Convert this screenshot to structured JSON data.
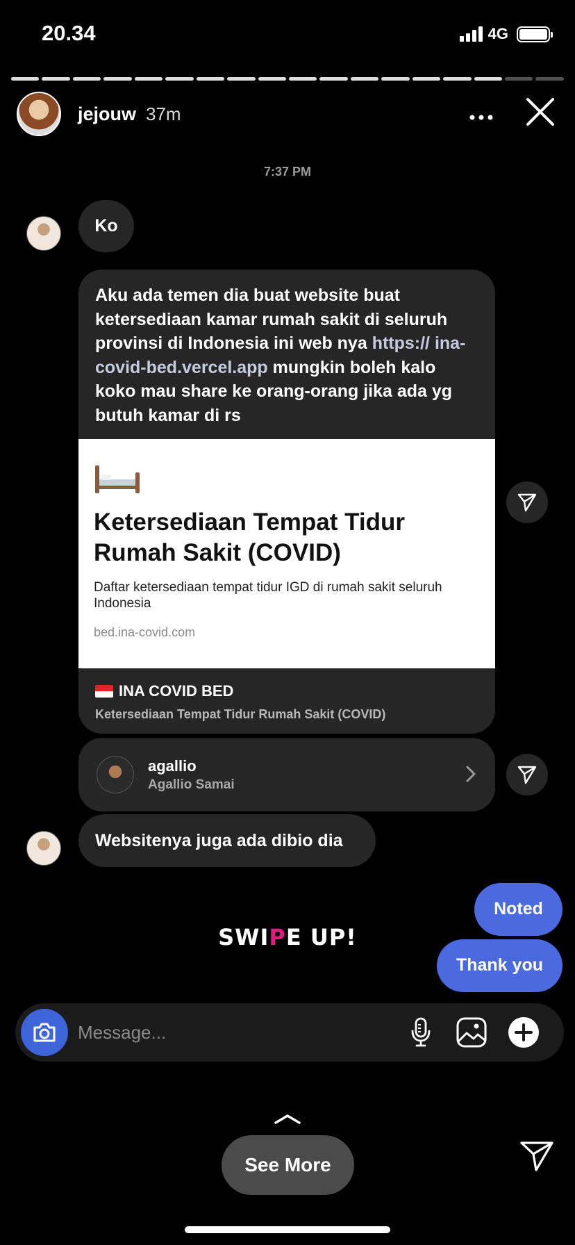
{
  "status_bar": {
    "time": "20.34",
    "network": "4G"
  },
  "story": {
    "segments_total": 18,
    "segments_viewed": 16
  },
  "header": {
    "username": "jejouw",
    "time_ago": "37m",
    "more_icon": "more-horizontal-icon",
    "close_icon": "close-icon"
  },
  "chat": {
    "timestamp": "7:37 PM",
    "msg1": "Ko",
    "msg2_part1": "Aku ada temen dia buat website buat ketersediaan kamar rumah sakit di seluruh provinsi di Indonesia ini web nya ",
    "msg2_link": "https:// ina-covid-bed.vercel.app",
    "msg2_part2": " mungkin boleh kalo koko mau share ke orang-orang jika ada yg butuh kamar di rs",
    "preview": {
      "title": "Ketersediaan Tempat Tidur Rumah Sakit (COVID)",
      "description": "Daftar ketersediaan tempat tidur IGD di rumah sakit seluruh Indonesia",
      "url": "bed.ina-covid.com",
      "site_name": "INA COVID BED",
      "site_subtitle": "Ketersediaan Tempat Tidur Rumah Sakit (COVID)"
    },
    "profile": {
      "username": "agallio",
      "full_name": "Agallio Samai"
    },
    "msg3": "Websitenya juga ada dibio dia",
    "out1": "Noted",
    "out2": "Thank you"
  },
  "sticker": {
    "part1": "SWI",
    "part2": "P",
    "part3": "E UP!"
  },
  "composer": {
    "placeholder": "Message..."
  },
  "footer": {
    "see_more": "See More"
  },
  "colors": {
    "outgoing_bubble": "#4b6ae0",
    "incoming_bubble": "#262626",
    "camera_button": "#3d64d8",
    "sticker_accent": "#e11c7e"
  }
}
